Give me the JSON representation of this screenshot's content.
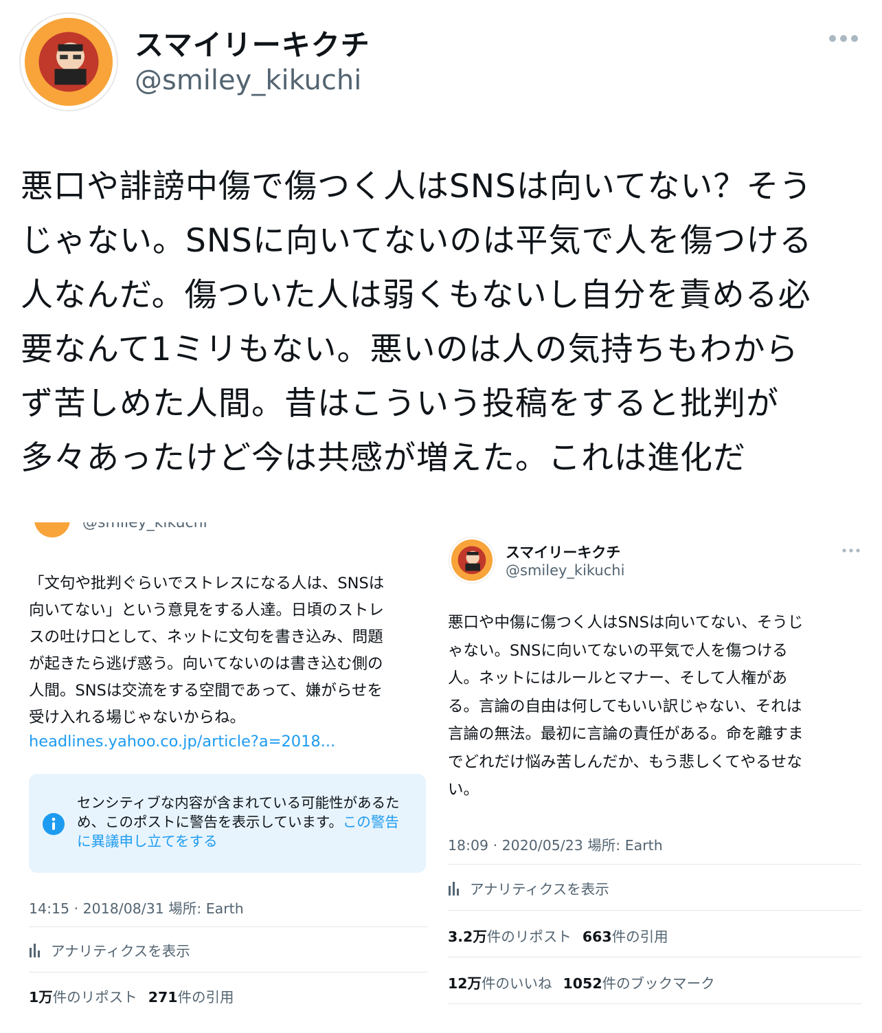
{
  "main_post": {
    "display_name": "スマイリーキクチ",
    "handle": "@smiley_kikuchi",
    "text": "悪口や誹謗中傷で傷つく人はSNSは向いてない？そう\nじゃない。SNSに向いてないのは平気で人を傷つける\n人なんだ。傷ついた人は弱くもないし自分を責める必\n要なんて1ミリもない。悪いのは人の気持ちもわから\nず苦しめた人間。昔はこういう投稿をすると批判が\n多々あったけど今は共感が増えた。これは進化だ"
  },
  "left_screenshot": {
    "handle_cut": "@smiley_kikuchi",
    "text": "「文句や批判ぐらいでストレスになる人は、SNSは\n向いてない」という意見をする人達。日頃のストレ\nスの吐け口として、ネットに文句を書き込み、問題\nが起きたら逃げ惑う。向いてないのは書き込む側の\n人間。SNSは交流をする空間であって、嫌がらせを\n受け入れる場じゃないからね。",
    "link": "headlines.yahoo.co.jp/article?a=2018...",
    "warning_text": "センシティブな内容が含まれている可能性があるた\nめ、このポストに警告を表示しています。",
    "warning_link": "この警告\nに異議申し立てをする",
    "meta": "14:15 · 2018/08/31 場所: Earth",
    "analytics": "アナリティクスを表示",
    "reposts_num": "1万",
    "reposts_label": "件のリポスト",
    "quotes_num": "271",
    "quotes_label": "件の引用"
  },
  "right_screenshot": {
    "display_name": "スマイリーキクチ",
    "handle": "@smiley_kikuchi",
    "text": "悪口や中傷に傷つく人はSNSは向いてない、そうじ\nゃない。SNSに向いてないの平気で人を傷つける\n人。ネットにはルールとマナー、そして人権があ\nる。言論の自由は何してもいい訳じゃない、それは\n言論の無法。最初に言論の責任がある。命を離すま\nでどれだけ悩み苦しんだか、もう悲しくてやるせな\nい。",
    "meta": "18:09 · 2020/05/23 場所: Earth",
    "analytics": "アナリティクスを表示",
    "reposts_num": "3.2万",
    "reposts_label": "件のリポスト",
    "quotes_num": "663",
    "quotes_label": "件の引用",
    "likes_num": "12万",
    "likes_label": "件のいいね",
    "bookmarks_num": "1052",
    "bookmarks_label": "件のブックマーク"
  },
  "colors": {
    "accent": "#1d9bf0",
    "secondary_text": "#536471",
    "warning_bg": "#e8f4fd",
    "avatar_orange": "#f8a43a"
  },
  "icons": [
    "avatar",
    "more-icon",
    "info-icon",
    "analytics-icon"
  ]
}
